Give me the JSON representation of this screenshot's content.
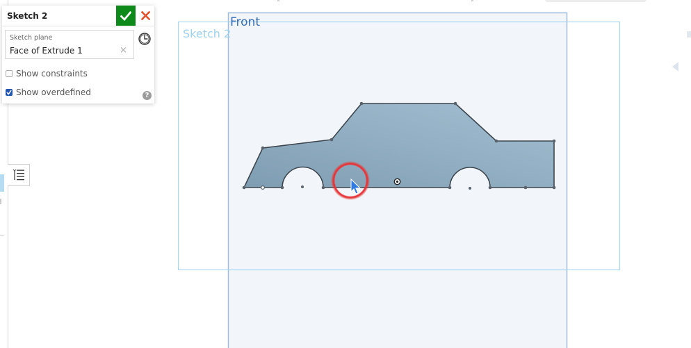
{
  "feature_panel": {
    "title": "Sketch 2",
    "accept_icon": "checkmark-icon",
    "cancel_icon": "close-icon",
    "sketch_plane": {
      "label": "Sketch plane",
      "value": "Face of Extrude 1",
      "clear_icon": "clear-x-icon"
    },
    "history_icon": "clock-icon",
    "options": [
      {
        "label": "Show constraints",
        "checked": false
      },
      {
        "label": "Show overdefined",
        "checked": true
      }
    ],
    "help_icon": "question-icon"
  },
  "viewport": {
    "planes": [
      {
        "name": "Front",
        "color": "#3a6fb8"
      },
      {
        "name": "Sketch 2",
        "color": "#9ed2ef"
      }
    ],
    "sketch_fill": "#8aa8bd",
    "cursor_highlight_color": "#e53935",
    "cursor_icon": "pointer-cursor-icon",
    "origin_icon": "origin-point-icon"
  },
  "left_rail": {
    "tab_icon": "feature-list-icon"
  },
  "right_rail": {
    "collapse_icon": "collapse-left-arrow-icon"
  },
  "symbols": {
    "check": "✔",
    "x": "✕",
    "clear": "×",
    "help": "?"
  }
}
